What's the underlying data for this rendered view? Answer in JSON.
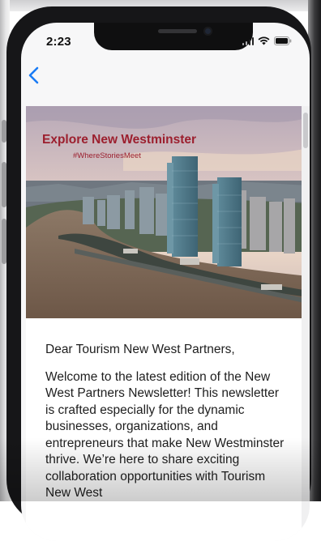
{
  "status_bar": {
    "time": "2:23",
    "icons": [
      "signal-icon",
      "wifi-icon",
      "battery-icon"
    ]
  },
  "nav": {
    "back_icon": "chevron-left-icon",
    "accent_color": "#1a7cf5"
  },
  "hero": {
    "title": "Explore New Westminster",
    "hashtag": "#WhereStoriesMeet",
    "title_color": "#9c1f2e"
  },
  "letter": {
    "greeting": "Dear Tourism New West Partners,",
    "body": "Welcome to the latest edition of the New West Partners Newsletter! This newsletter is crafted especially for the dynamic businesses, organizations, and entrepreneurs that make New Westminster thrive. We’re here to share exciting collaboration opportunities with Tourism New West"
  }
}
